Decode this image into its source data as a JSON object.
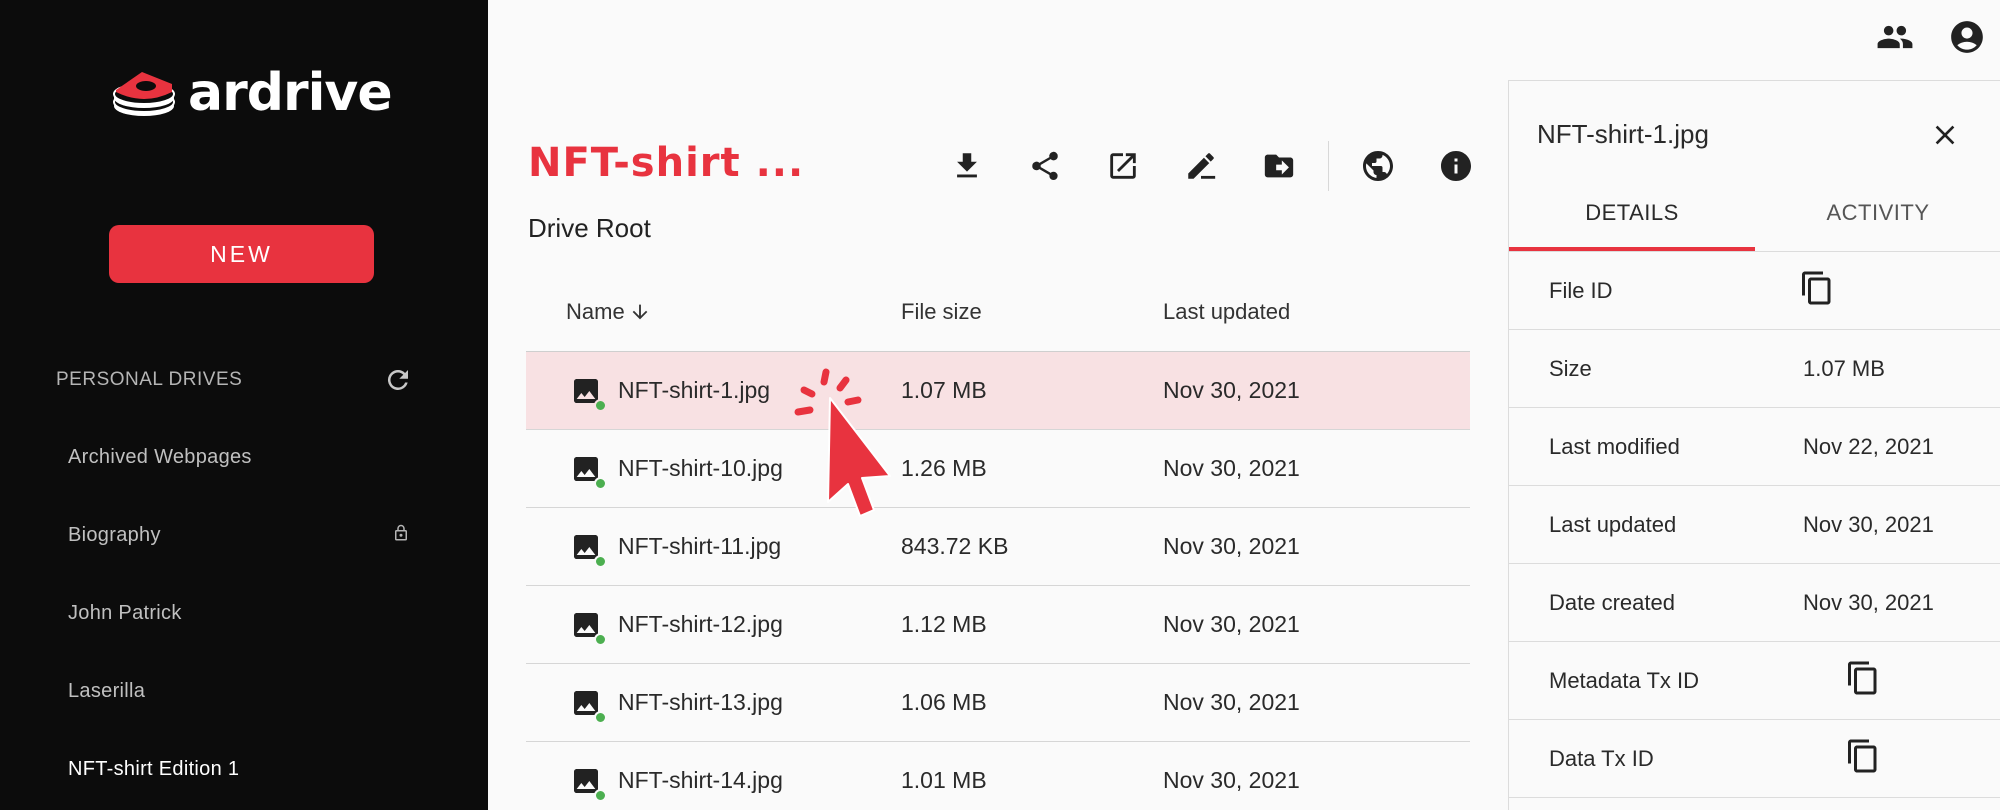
{
  "sidebar": {
    "logo_text": "ardrive",
    "new_button": "NEW",
    "drives_header": "PERSONAL DRIVES",
    "drives": [
      {
        "label": "Archived Webpages",
        "locked": false
      },
      {
        "label": "Biography",
        "locked": true
      },
      {
        "label": "John Patrick",
        "locked": false
      },
      {
        "label": "Laserilla",
        "locked": false
      },
      {
        "label": "NFT-shirt Edition 1",
        "locked": false,
        "active": true
      }
    ]
  },
  "topbar": {
    "icons": [
      "people-icon",
      "account-circle-icon"
    ]
  },
  "main": {
    "folder_title": "NFT-shirt ...",
    "breadcrumb": "Drive Root",
    "toolbar": [
      "download-icon",
      "share-icon",
      "open-in-new-icon",
      "rename-icon",
      "move-folder-icon",
      "globe-icon",
      "info-icon"
    ],
    "table": {
      "columns": {
        "name": "Name",
        "size": "File size",
        "updated": "Last updated"
      },
      "rows": [
        {
          "name": "NFT-shirt-1.jpg",
          "size": "1.07 MB",
          "updated": "Nov 30, 2021"
        },
        {
          "name": "NFT-shirt-10.jpg",
          "size": "1.26 MB",
          "updated": "Nov 30, 2021"
        },
        {
          "name": "NFT-shirt-11.jpg",
          "size": "843.72 KB",
          "updated": "Nov 30, 2021"
        },
        {
          "name": "NFT-shirt-12.jpg",
          "size": "1.12 MB",
          "updated": "Nov 30, 2021"
        },
        {
          "name": "NFT-shirt-13.jpg",
          "size": "1.06 MB",
          "updated": "Nov 30, 2021"
        },
        {
          "name": "NFT-shirt-14.jpg",
          "size": "1.01 MB",
          "updated": "Nov 30, 2021"
        }
      ]
    }
  },
  "details": {
    "title": "NFT-shirt-1.jpg",
    "tabs": [
      "DETAILS",
      "ACTIVITY"
    ],
    "rows": [
      {
        "label": "File ID",
        "value": null,
        "copy": true
      },
      {
        "label": "Size",
        "value": "1.07 MB",
        "copy": false
      },
      {
        "label": "Last modified",
        "value": "Nov 22, 2021",
        "copy": false
      },
      {
        "label": "Last updated",
        "value": "Nov 30, 2021",
        "copy": false
      },
      {
        "label": "Date created",
        "value": "Nov 30, 2021",
        "copy": false
      },
      {
        "label": "Metadata Tx ID",
        "value": null,
        "copy": true
      },
      {
        "label": "Data Tx ID",
        "value": null,
        "copy": true
      }
    ]
  },
  "colors": {
    "accent": "#e8333f",
    "sidebar_bg": "#0c0c0c",
    "selected_row": "#f8e1e3",
    "synced_dot": "#4caf50"
  }
}
